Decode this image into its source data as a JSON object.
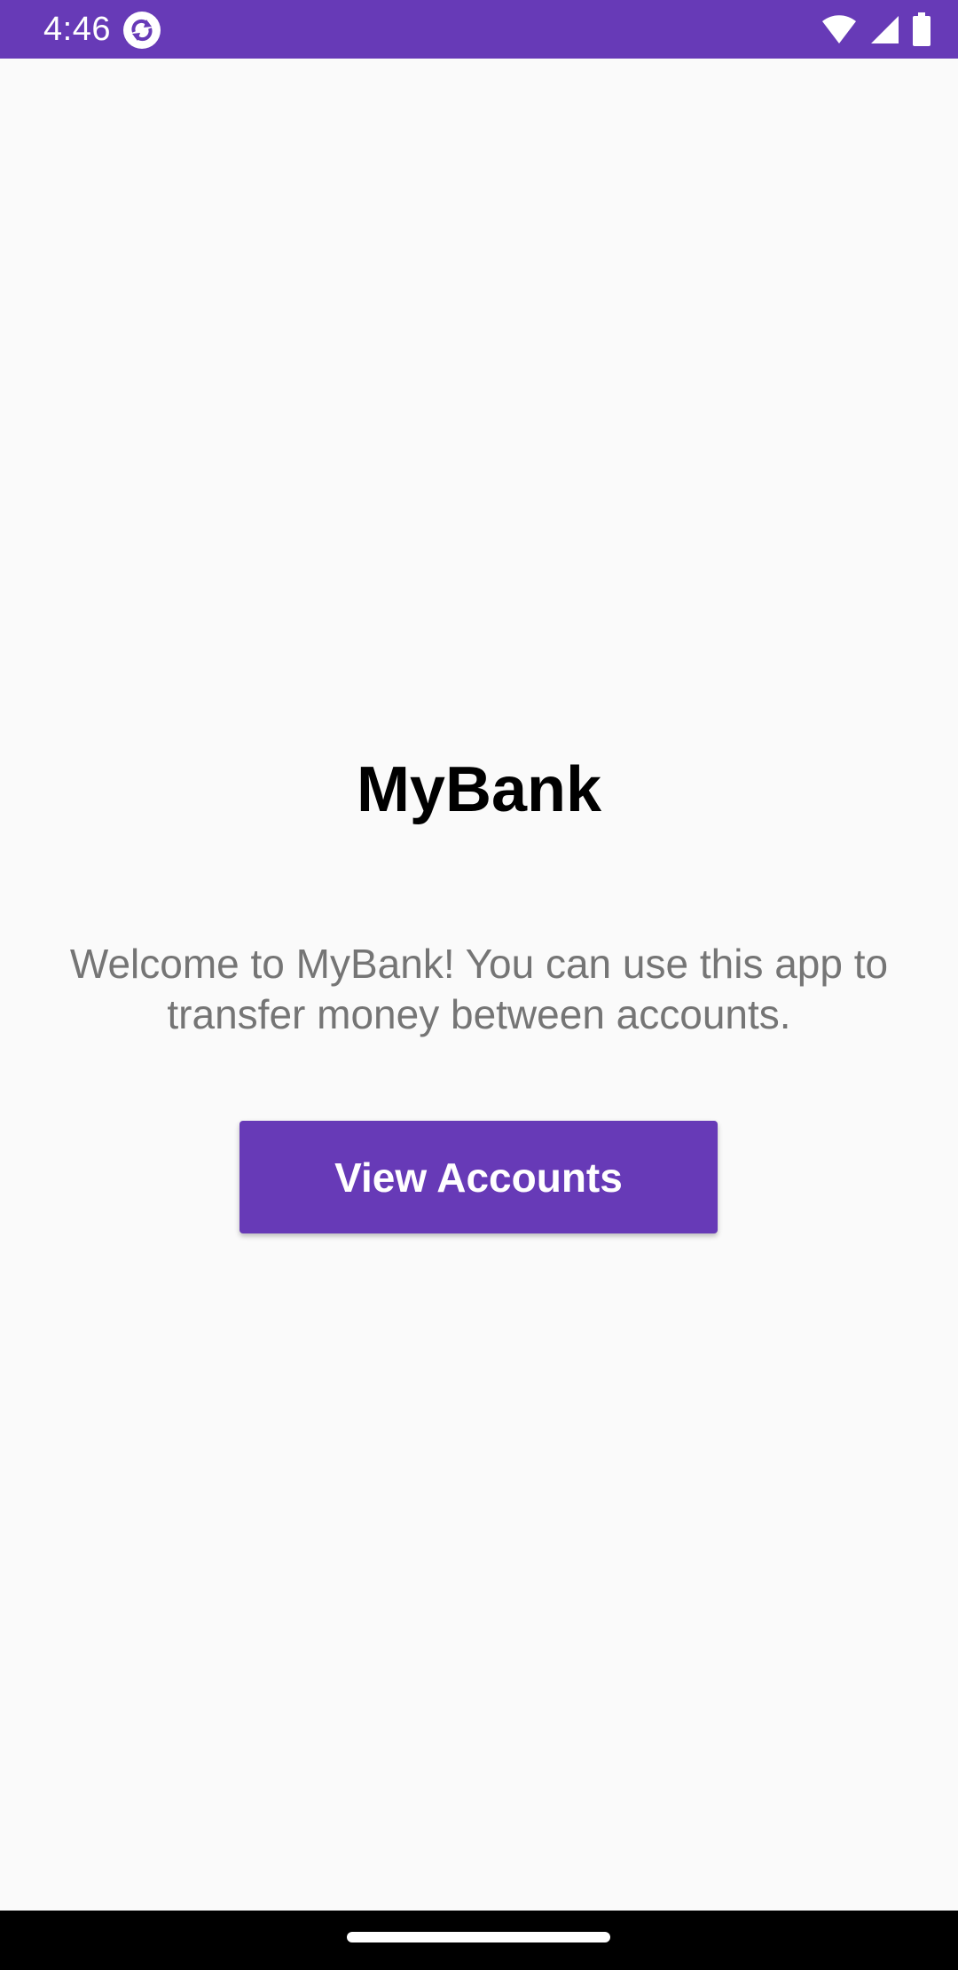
{
  "status_bar": {
    "time": "4:46",
    "app_icon": "sync-app-icon",
    "wifi_icon": "wifi-icon",
    "signal_icon": "cellular-signal-icon",
    "battery_icon": "battery-icon",
    "background_color": "#673ab7"
  },
  "main": {
    "title": "MyBank",
    "welcome_text": "Welcome to MyBank! You can use this app to transfer money between accounts.",
    "view_accounts_label": "View Accounts",
    "accent_color": "#673ab7"
  },
  "nav_bar": {
    "home_handle": "home-gesture-handle"
  }
}
